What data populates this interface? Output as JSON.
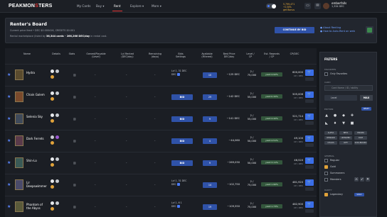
{
  "app": {
    "logo_a": "PEAKMON",
    "logo_o": "S",
    "logo_b": "TERS"
  },
  "nav": [
    {
      "label": "My Cards"
    },
    {
      "label": "Buy ▾"
    },
    {
      "label": "Rent"
    },
    {
      "label": "Explore ▾"
    },
    {
      "label": "More ▾"
    }
  ],
  "promo": {
    "line1": "5,799,471",
    "line2": "+130%",
    "line3": "get Bonus"
  },
  "user": {
    "name": "emberfalls",
    "balance": "1,334 DEC"
  },
  "board": {
    "title": "Renter's Board",
    "line1": "Current price feed • DEC $0.000416, CREDITS $0.001",
    "line2_prefix": "Rental marketplace (listed by",
    "listed_count": "36,344 cards",
    "line2_mid": "•",
    "dec_total": "266,266 DEC/day",
    "line2_suffix": "in rental cost.",
    "cta": "CONTINUE BY BID",
    "help1": "About Renting",
    "help2": "How to Auto-Rent on web"
  },
  "table": {
    "headers": {
      "name": "Name",
      "details": "Details",
      "stats": "Stats",
      "owned": "Owned/Playable\n(Level)",
      "rented": "Lvl Rented\n(DEC/day)",
      "remaining": "Remaining\n(days)",
      "bid": "Bids\nSettings",
      "avail": "Available\n(Filtered)",
      "best": "Best Price\nDEC/day",
      "lvl": "Level /\nCP",
      "reward": "Est. Rewards\n/ CP",
      "cpdec": "CP/DEC"
    },
    "rows": [
      {
        "name": "Hydra",
        "owned": "-",
        "rented": "-",
        "remaining": "-",
        "bid_line1": "Lvl 1, 31 DEC",
        "bid_line2": "DEC",
        "avail": "10",
        "best": "~125 DEC",
        "lvl": "2 /",
        "cp": "75,000",
        "reward": "yield 4.92%",
        "cpdec": "600,000",
        "cpdec_sub": "CP / DEC"
      },
      {
        "name": "Chain Golem",
        "owned": "-",
        "rented": "-",
        "remaining": "-",
        "bid": "BID",
        "avail": "29",
        "best": "~142 DEC",
        "lvl": "2 /",
        "cp": "55,000",
        "reward": "yield 0.32%",
        "cpdec": "505,006",
        "cpdec_sub": "CP / DEC"
      },
      {
        "name": "Selenia Sky",
        "owned": "-",
        "rented": "-",
        "remaining": "-",
        "bid": "BID",
        "avail": "9",
        "best": "~141 DEC",
        "lvl": "2 /",
        "cp": "55,000",
        "reward": "yield 4.42%",
        "cpdec": "521,714",
        "cpdec_sub": "CP / DEC"
      },
      {
        "name": "Dark Ferrets",
        "owned": "-",
        "rented": "-",
        "remaining": "-",
        "bid": "BID",
        "avail": "4",
        "best": "~44,060",
        "lvl": "2 /",
        "cp": "50,000",
        "reward": "yield 4.51%",
        "cpdec": "49,100",
        "cpdec_sub": "CP / DEC"
      },
      {
        "name": "Shin-Lo",
        "owned": "-",
        "rented": "-",
        "remaining": "-",
        "bid": "BID",
        "avail": "9",
        "best": "~269,030",
        "lvl": "2 /",
        "cp": "50,000",
        "reward": "yield 3.11%",
        "cpdec": "46,520",
        "cpdec_sub": "CP / DEC"
      },
      {
        "name": "Lir Deepswimmer",
        "owned": "-",
        "rented": "-",
        "remaining": "-",
        "bid_line1": "Lvl 1, 31 DEC",
        "bid_line2": "DEC",
        "avail": "14",
        "best": "~102,750",
        "lvl": "2 /",
        "cp": "75,000",
        "reward": "yield 1.90%",
        "cpdec": "481,920",
        "cpdec_sub": "CP / DEC"
      },
      {
        "name": "Phantom of the Abyss",
        "owned": "-",
        "rented": "-",
        "remaining": "-",
        "bid_line1": "Lvl 1, 6 1",
        "bid_line2": "DEC",
        "avail": "19",
        "best": "~109,550",
        "lvl": "2 /",
        "cp": "75,000",
        "reward": "yield 1.73%",
        "cpdec": "482,900",
        "cpdec_sub": "CP / DEC"
      }
    ]
  },
  "filters": {
    "title": "FILTERS",
    "favorites_label": "Favorites",
    "only_favorites": "Only Favorites",
    "card_label": "Card",
    "card_placeholder": "Card Name / ID / ability",
    "level_text": "Level",
    "max_label": "MAX",
    "edition_label": "Edition",
    "reset_label": "RESET",
    "editions": [
      "ALPHA",
      "BETA",
      "PROMO",
      "REWARD",
      "UNTAMED",
      "DICE",
      "CHAOS",
      "RIFT",
      "SOULBOUND"
    ],
    "general_label": "General",
    "opt_regular": "Regular",
    "opt_gold": "Gold",
    "opt_summoners": "Summoners",
    "opt_monsters": "Monsters",
    "rarity_label": "Rarity",
    "opt_legendary": "Legendary",
    "legendary_tag": "SOLD"
  }
}
